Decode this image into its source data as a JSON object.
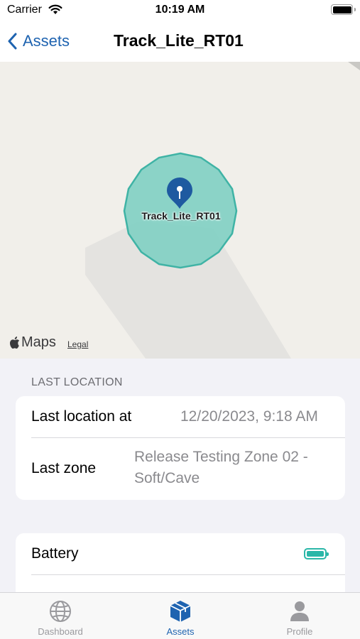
{
  "status_bar": {
    "carrier": "Carrier",
    "time": "10:19 AM",
    "wifi_icon": "wifi-icon",
    "battery_icon": "battery-icon"
  },
  "nav": {
    "back_label": "Assets",
    "back_icon": "chevron-left-icon",
    "title": "Track_Lite_RT01"
  },
  "map": {
    "asset_label": "Track_Lite_RT01",
    "maps_label": "Maps",
    "legal_label": "Legal",
    "zone_color": "#7fcfc3",
    "pin_color": "#1e5aa0"
  },
  "last_location": {
    "section_title": "LAST LOCATION",
    "last_location_label": "Last location at",
    "last_location_value": "12/20/2023, 9:18 AM",
    "last_zone_label": "Last zone",
    "last_zone_line1": "Release Testing Zone 02 -",
    "last_zone_line2": "Soft/Cave"
  },
  "device": {
    "battery_label": "Battery",
    "battery_icon": "battery-full-icon",
    "battery_color": "#2ab7a8"
  },
  "tabs": [
    {
      "label": "Dashboard",
      "icon": "globe-icon",
      "active": false
    },
    {
      "label": "Assets",
      "icon": "box-icon",
      "active": true
    },
    {
      "label": "Profile",
      "icon": "person-icon",
      "active": false
    }
  ],
  "colors": {
    "accent": "#1e63b0",
    "secondary_text": "#8a8a8e"
  }
}
